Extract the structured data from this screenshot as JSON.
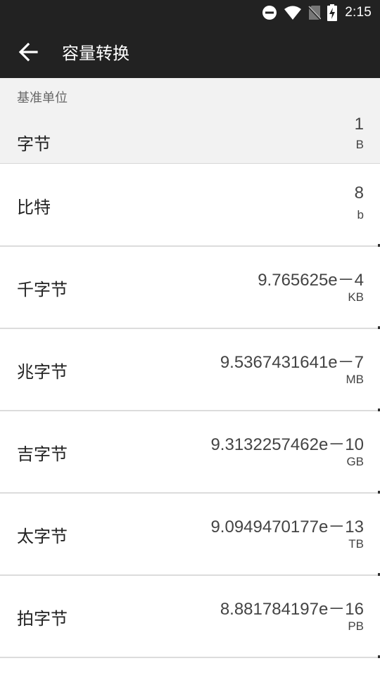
{
  "status": {
    "time": "2:15",
    "icons": [
      "do-not-disturb-icon",
      "wifi-icon",
      "no-sim-icon",
      "battery-charging-icon"
    ]
  },
  "appbar": {
    "title": "容量转换",
    "back_icon": "arrow-back-icon"
  },
  "base_unit": {
    "caption": "基准单位",
    "name": "字节",
    "value": "1",
    "unit": "B"
  },
  "units": [
    {
      "name": "比特",
      "value": "8",
      "unit": "b"
    },
    {
      "name": "千字节",
      "value": "9.765625e－4",
      "unit": "KB"
    },
    {
      "name": "兆字节",
      "value": "9.5367431641e－7",
      "unit": "MB"
    },
    {
      "name": "吉字节",
      "value": "9.3132257462e－10",
      "unit": "GB"
    },
    {
      "name": "太字节",
      "value": "9.0949470177e－13",
      "unit": "TB"
    },
    {
      "name": "拍字节",
      "value": "8.881784197e－16",
      "unit": "PB"
    }
  ],
  "colors": {
    "bar": "#222222",
    "base_bg": "#f2f2f2",
    "divider": "#dcdcdc"
  }
}
